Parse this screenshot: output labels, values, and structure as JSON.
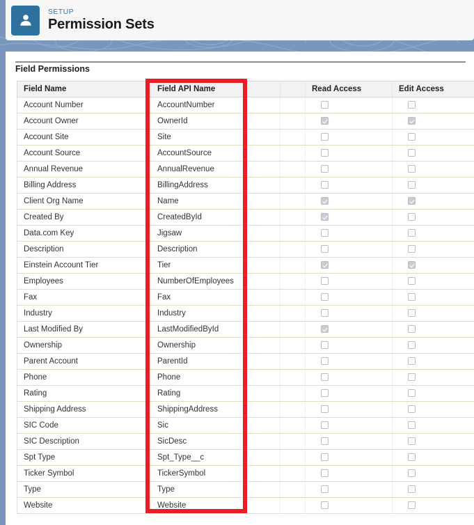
{
  "header": {
    "eyebrow": "SETUP",
    "title": "Permission Sets",
    "icon": "user-icon",
    "icon_color": "#2e719f"
  },
  "section": {
    "title": "Field Permissions"
  },
  "annotation": {
    "shape": "rectangle",
    "color": "#ec1c24",
    "target_column": "Field API Name"
  },
  "table": {
    "columns": [
      {
        "key": "field_name",
        "label": "Field Name"
      },
      {
        "key": "field_api_name",
        "label": "Field API Name"
      },
      {
        "key": "blank",
        "label": ""
      },
      {
        "key": "read_access",
        "label": "Read Access"
      },
      {
        "key": "edit_access",
        "label": "Edit Access"
      }
    ],
    "rows": [
      {
        "field_name": "Account Number",
        "field_api_name": "AccountNumber",
        "read_access": false,
        "edit_access": false
      },
      {
        "field_name": "Account Owner",
        "field_api_name": "OwnerId",
        "read_access": true,
        "edit_access": true
      },
      {
        "field_name": "Account Site",
        "field_api_name": "Site",
        "read_access": false,
        "edit_access": false
      },
      {
        "field_name": "Account Source",
        "field_api_name": "AccountSource",
        "read_access": false,
        "edit_access": false
      },
      {
        "field_name": "Annual Revenue",
        "field_api_name": "AnnualRevenue",
        "read_access": false,
        "edit_access": false
      },
      {
        "field_name": "Billing Address",
        "field_api_name": "BillingAddress",
        "read_access": false,
        "edit_access": false
      },
      {
        "field_name": "Client Org Name",
        "field_api_name": "Name",
        "read_access": true,
        "edit_access": true
      },
      {
        "field_name": "Created By",
        "field_api_name": "CreatedById",
        "read_access": true,
        "edit_access": false
      },
      {
        "field_name": "Data.com Key",
        "field_api_name": "Jigsaw",
        "read_access": false,
        "edit_access": false
      },
      {
        "field_name": "Description",
        "field_api_name": "Description",
        "read_access": false,
        "edit_access": false
      },
      {
        "field_name": "Einstein Account Tier",
        "field_api_name": "Tier",
        "read_access": true,
        "edit_access": true
      },
      {
        "field_name": "Employees",
        "field_api_name": "NumberOfEmployees",
        "read_access": false,
        "edit_access": false
      },
      {
        "field_name": "Fax",
        "field_api_name": "Fax",
        "read_access": false,
        "edit_access": false
      },
      {
        "field_name": "Industry",
        "field_api_name": "Industry",
        "read_access": false,
        "edit_access": false
      },
      {
        "field_name": "Last Modified By",
        "field_api_name": "LastModifiedById",
        "read_access": true,
        "edit_access": false
      },
      {
        "field_name": "Ownership",
        "field_api_name": "Ownership",
        "read_access": false,
        "edit_access": false
      },
      {
        "field_name": "Parent Account",
        "field_api_name": "ParentId",
        "read_access": false,
        "edit_access": false
      },
      {
        "field_name": "Phone",
        "field_api_name": "Phone",
        "read_access": false,
        "edit_access": false
      },
      {
        "field_name": "Rating",
        "field_api_name": "Rating",
        "read_access": false,
        "edit_access": false
      },
      {
        "field_name": "Shipping Address",
        "field_api_name": "ShippingAddress",
        "read_access": false,
        "edit_access": false
      },
      {
        "field_name": "SIC Code",
        "field_api_name": "Sic",
        "read_access": false,
        "edit_access": false
      },
      {
        "field_name": "SIC Description",
        "field_api_name": "SicDesc",
        "read_access": false,
        "edit_access": false
      },
      {
        "field_name": "Spt Type",
        "field_api_name": "Spt_Type__c",
        "read_access": false,
        "edit_access": false
      },
      {
        "field_name": "Ticker Symbol",
        "field_api_name": "TickerSymbol",
        "read_access": false,
        "edit_access": false
      },
      {
        "field_name": "Type",
        "field_api_name": "Type",
        "read_access": false,
        "edit_access": false
      },
      {
        "field_name": "Website",
        "field_api_name": "Website",
        "read_access": false,
        "edit_access": false
      }
    ]
  }
}
